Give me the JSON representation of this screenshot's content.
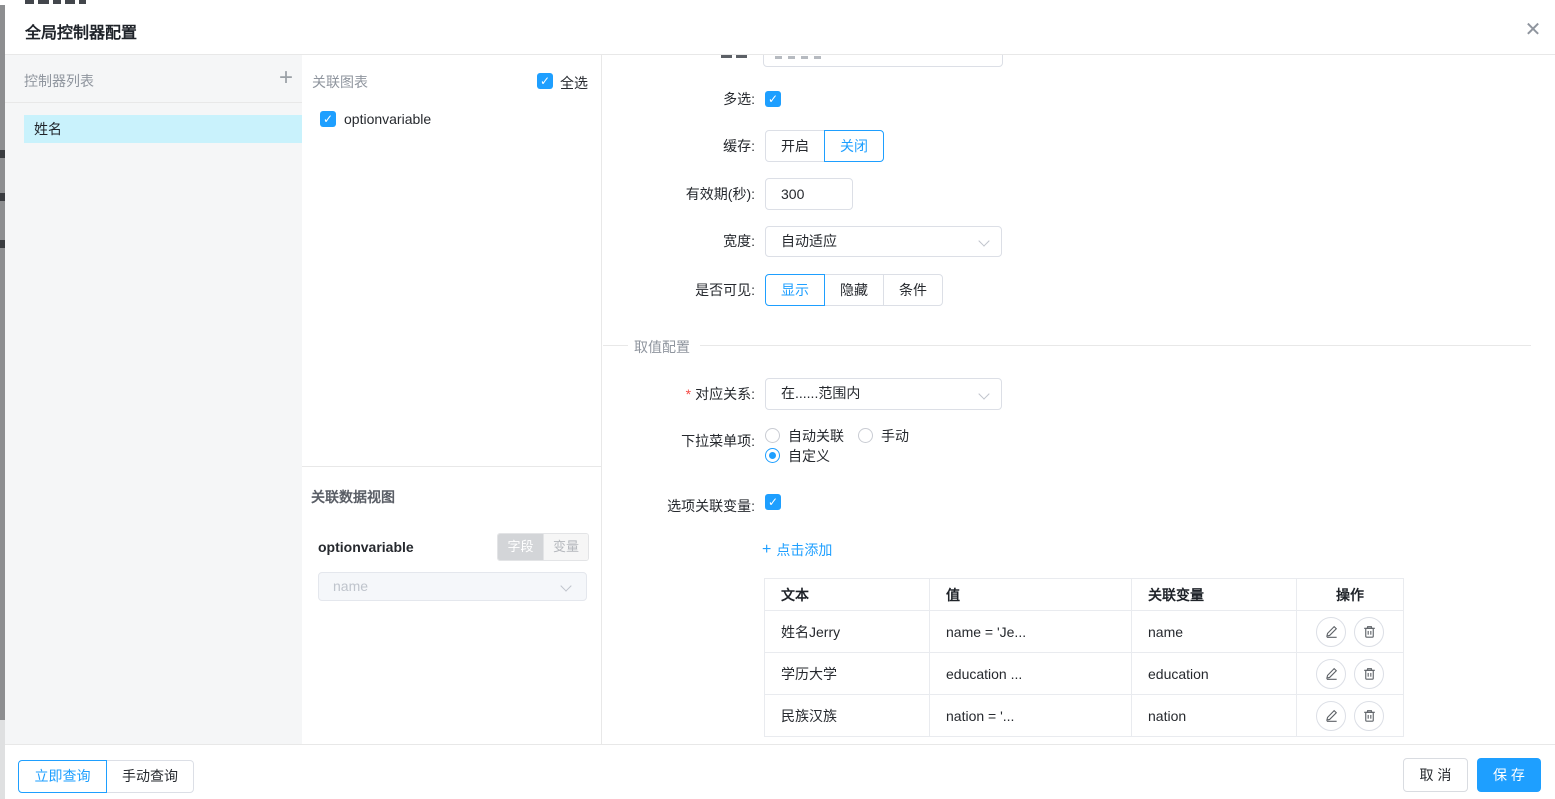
{
  "icons": {
    "close": "✕",
    "add": "+",
    "check": "✓"
  },
  "colors": {
    "accent": "#1e9fff",
    "selected_item_bg": "#c9f2fc"
  },
  "dialog": {
    "title": "全局控制器配置"
  },
  "left_panel": {
    "header": "控制器列表",
    "items": [
      {
        "label": "姓名",
        "selected": true
      }
    ]
  },
  "charts_panel": {
    "header": "关联图表",
    "select_all_label": "全选",
    "select_all_checked": true,
    "items": [
      {
        "label": "optionvariable",
        "checked": true
      }
    ]
  },
  "dataview_panel": {
    "header": "关联数据视图",
    "item_label": "optionvariable",
    "toggle": {
      "field_label": "字段",
      "variable_label": "变量",
      "active": "字段"
    },
    "field_select": {
      "value": "name"
    }
  },
  "form": {
    "multi_select": {
      "label": "多选:",
      "checked": true
    },
    "cache": {
      "label": "缓存:",
      "options": [
        "开启",
        "关闭"
      ],
      "selected": "关闭"
    },
    "validity": {
      "label": "有效期(秒):",
      "value": "300"
    },
    "width": {
      "label": "宽度:",
      "value": "自动适应"
    },
    "visibility": {
      "label": "是否可见:",
      "options": [
        "显示",
        "隐藏",
        "条件"
      ],
      "selected": "显示"
    },
    "section_title": "取值配置",
    "relation": {
      "required_mark": "*",
      "label": "对应关系:",
      "value": "在......范围内"
    },
    "dropdown_items": {
      "label": "下拉菜单项:",
      "options": [
        "自动关联",
        "手动",
        "自定义"
      ],
      "selected": "自定义"
    },
    "option_variable": {
      "label": "选项关联变量:",
      "checked": true
    },
    "add_link_label": "点击添加",
    "table": {
      "headers": [
        "文本",
        "值",
        "关联变量",
        "操作"
      ],
      "rows": [
        {
          "text": "姓名Jerry",
          "value": "name = 'Je...",
          "variable": "name"
        },
        {
          "text": "学历大学",
          "value": "education ...",
          "variable": "education"
        },
        {
          "text": "民族汉族",
          "value": "nation = '...",
          "variable": "nation"
        }
      ]
    }
  },
  "footer": {
    "query_options": [
      "立即查询",
      "手动查询"
    ],
    "query_selected": "立即查询",
    "cancel_label": "取 消",
    "save_label": "保 存"
  }
}
